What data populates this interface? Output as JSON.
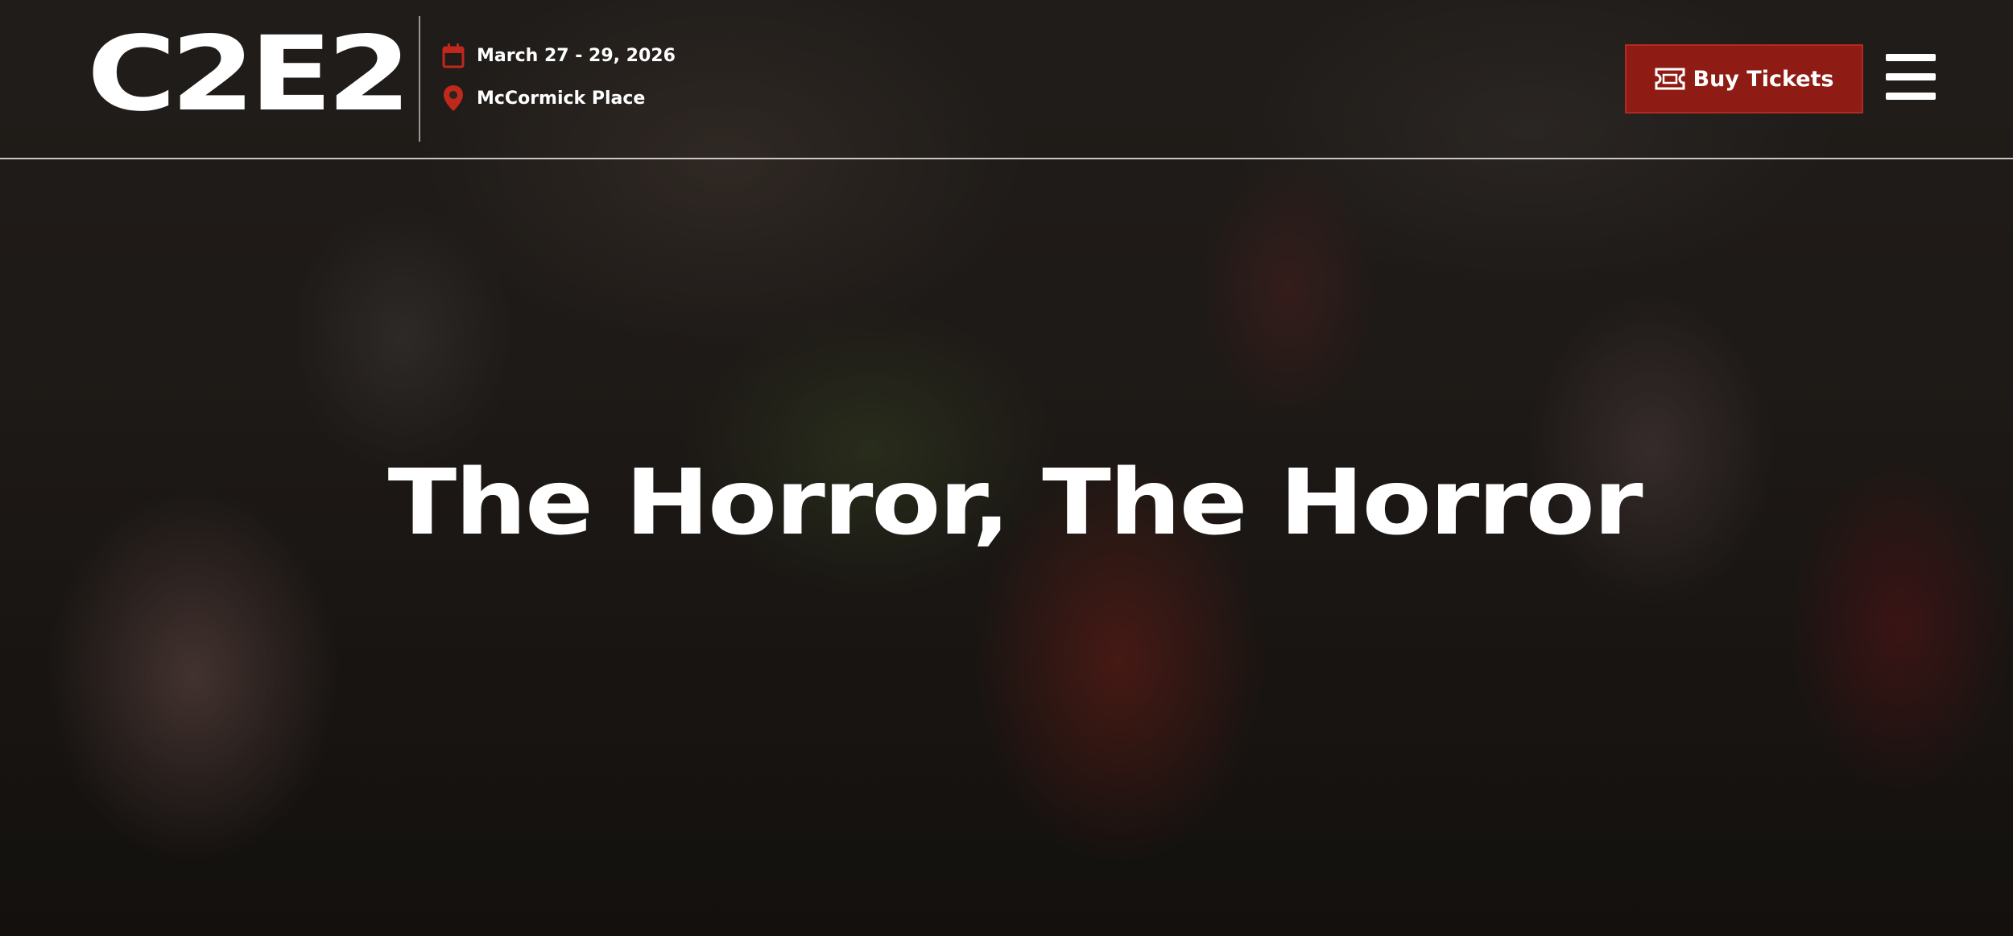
{
  "header": {
    "logo_text": "C2E2",
    "logo_tm": "™",
    "event_date": "March 27 - 29, 2026",
    "event_location": "McCormick Place",
    "buy_tickets_label": "Buy Tickets",
    "icons": {
      "date": "calendar-icon",
      "location": "map-pin-icon",
      "tickets": "ticket-icon",
      "menu": "hamburger-menu-icon"
    }
  },
  "hero": {
    "title": "The Horror, The Horror"
  },
  "colors": {
    "accent": "#8e1b14",
    "icon_red": "#c0281c",
    "text": "#ffffff"
  }
}
